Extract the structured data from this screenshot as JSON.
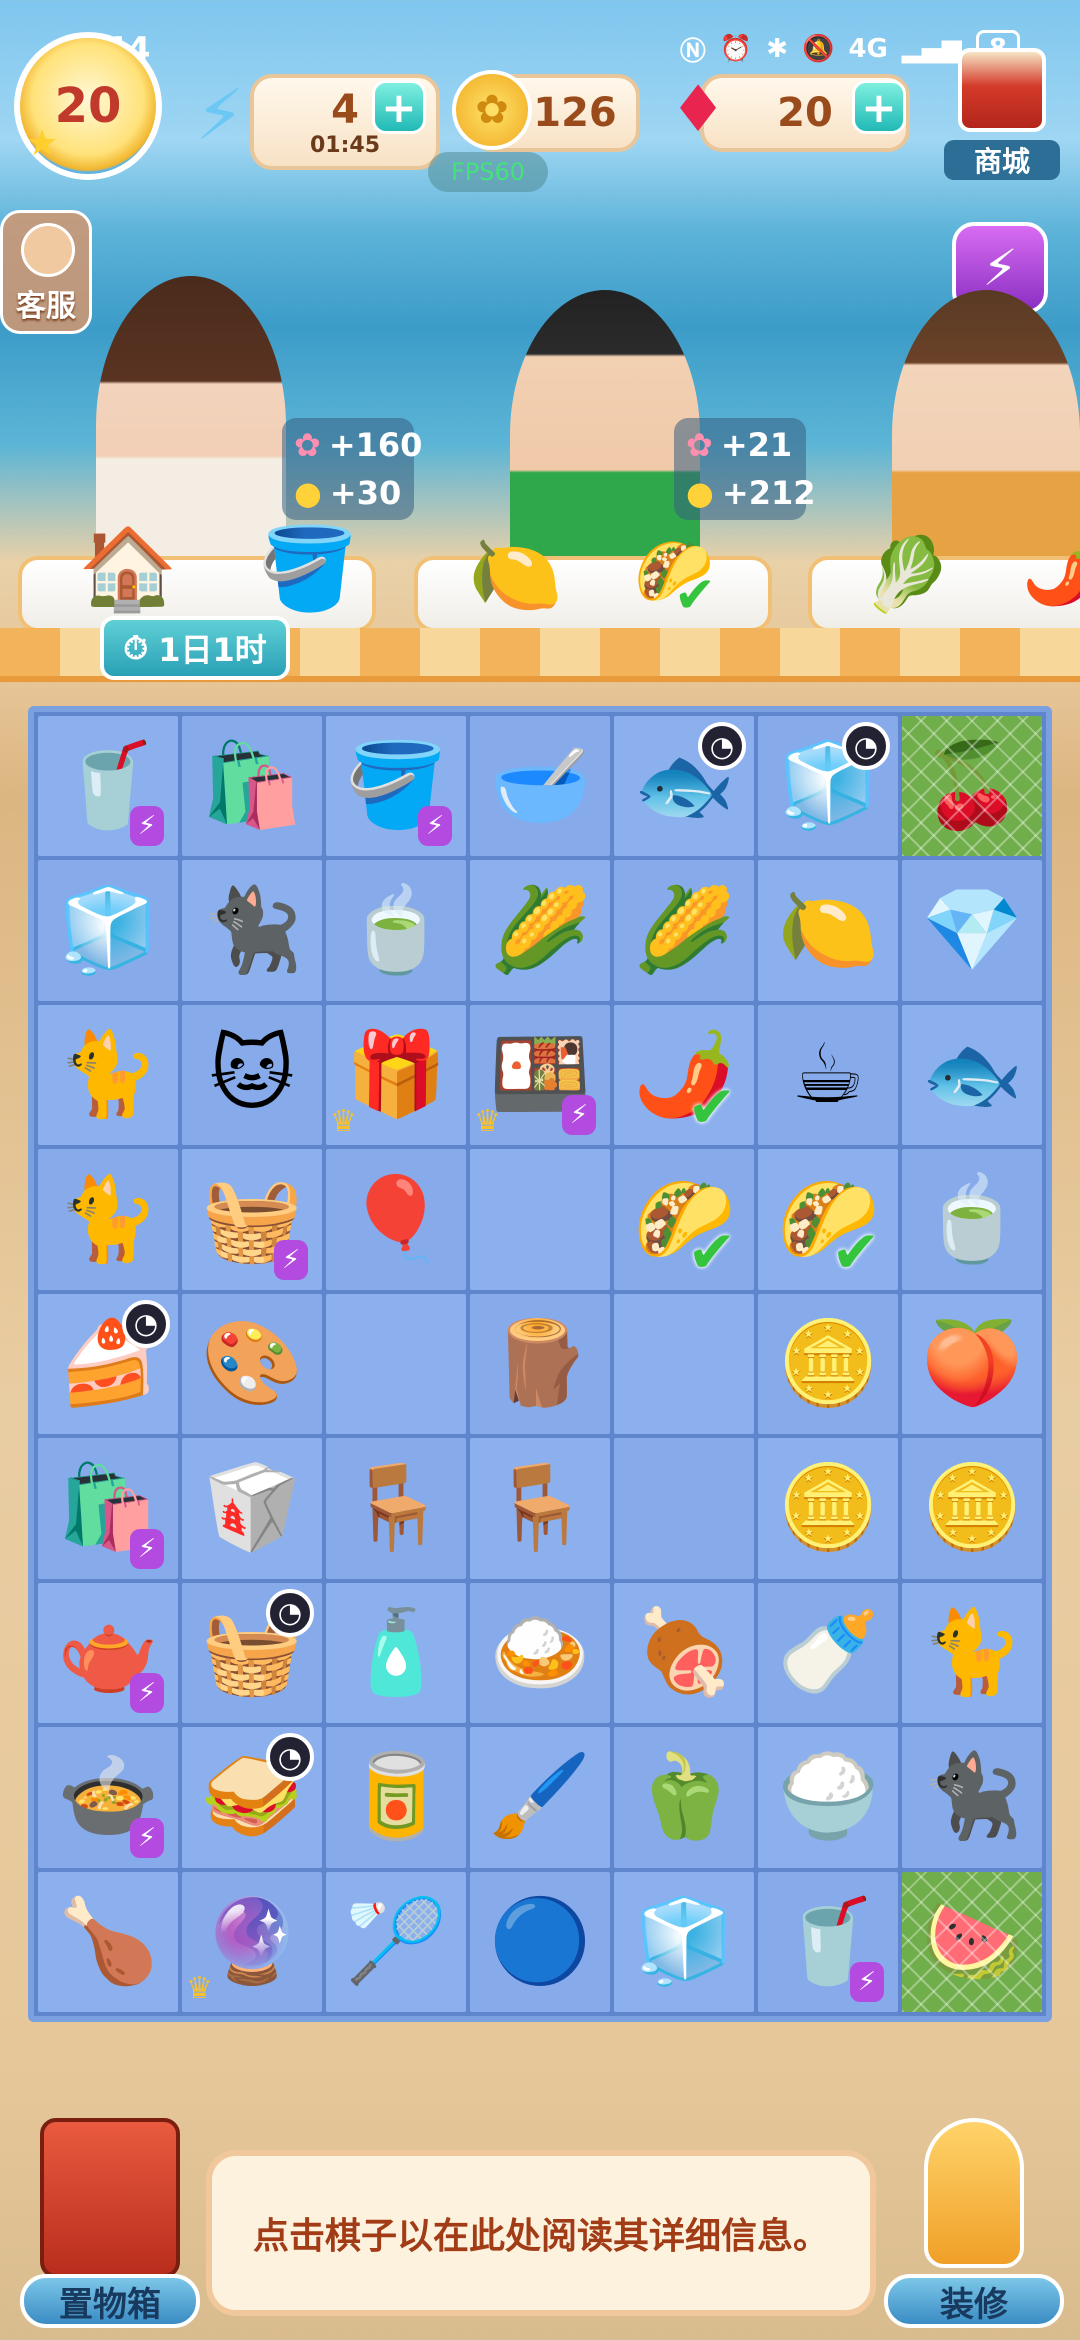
{
  "status_bar": {
    "time": "2:44",
    "battery": "8",
    "network": "4G"
  },
  "hud": {
    "level": "20",
    "energy": {
      "value": "4",
      "timer": "01:45"
    },
    "coins": "126",
    "gems": "20",
    "fps": "FPS60",
    "shop_label": "商城",
    "service_label": "客服"
  },
  "customers": [
    {
      "flower": "+160",
      "coin": "+30"
    },
    {
      "flower": "+21",
      "coin": "+212"
    }
  ],
  "order_timer": "1日1时",
  "board": {
    "rows": [
      [
        {
          "i": "🥤",
          "bolt": true
        },
        {
          "i": "🛍️"
        },
        {
          "i": "🪣",
          "bolt": true
        },
        {
          "i": "🥣"
        },
        {
          "i": "🐟",
          "clock": true
        },
        {
          "i": "🧊",
          "clock": true
        },
        {
          "i": "🍒",
          "web": true
        }
      ],
      [
        {
          "i": "🧊"
        },
        {
          "i": "🐈‍⬛"
        },
        {
          "i": "🍵"
        },
        {
          "i": "🌽"
        },
        {
          "i": "🌽"
        },
        {
          "i": "🍋"
        },
        {
          "i": "💎"
        }
      ],
      [
        {
          "i": "🐈"
        },
        {
          "i": "🐱"
        },
        {
          "i": "🎁",
          "crown": true
        },
        {
          "i": "🍱",
          "crown": true,
          "bolt": true
        },
        {
          "i": "🌶️",
          "check": true
        },
        {
          "i": "☕"
        },
        {
          "i": "🐟"
        }
      ],
      [
        {
          "i": "🐈"
        },
        {
          "i": "🧺",
          "bolt": true
        },
        {
          "i": "🎈"
        },
        {
          "i": ""
        },
        {
          "i": "🌮",
          "check": true
        },
        {
          "i": "🌮",
          "check": true
        },
        {
          "i": "🍵"
        }
      ],
      [
        {
          "i": "🍰",
          "clock": true
        },
        {
          "i": "🎨"
        },
        {
          "i": ""
        },
        {
          "i": "🪵"
        },
        {
          "i": ""
        },
        {
          "i": "🪙"
        },
        {
          "i": "🍑"
        }
      ],
      [
        {
          "i": "🛍️",
          "bolt": true
        },
        {
          "i": "🥡"
        },
        {
          "i": "🪑"
        },
        {
          "i": "🪑"
        },
        {
          "i": ""
        },
        {
          "i": "🪙"
        },
        {
          "i": "🪙"
        }
      ],
      [
        {
          "i": "🫖",
          "bolt": true
        },
        {
          "i": "🧺",
          "clock": true
        },
        {
          "i": "🧴"
        },
        {
          "i": "🍛"
        },
        {
          "i": "🍖"
        },
        {
          "i": "🍼"
        },
        {
          "i": "🐈"
        }
      ],
      [
        {
          "i": "🍲",
          "bolt": true
        },
        {
          "i": "🥪",
          "clock": true
        },
        {
          "i": "🥫"
        },
        {
          "i": "🖌️"
        },
        {
          "i": "🫑"
        },
        {
          "i": "🍚"
        },
        {
          "i": "🐈‍⬛"
        }
      ],
      [
        {
          "i": "🍗"
        },
        {
          "i": "🔮",
          "crown": true
        },
        {
          "i": "🏸"
        },
        {
          "i": "🔵"
        },
        {
          "i": "🧊"
        },
        {
          "i": "🥤",
          "bolt": true
        },
        {
          "i": "🍉",
          "web": true
        }
      ]
    ]
  },
  "bottom": {
    "storage_label": "置物箱",
    "info_text": "点击棋子以在此处阅读其详细信息。",
    "decorate_label": "装修"
  }
}
